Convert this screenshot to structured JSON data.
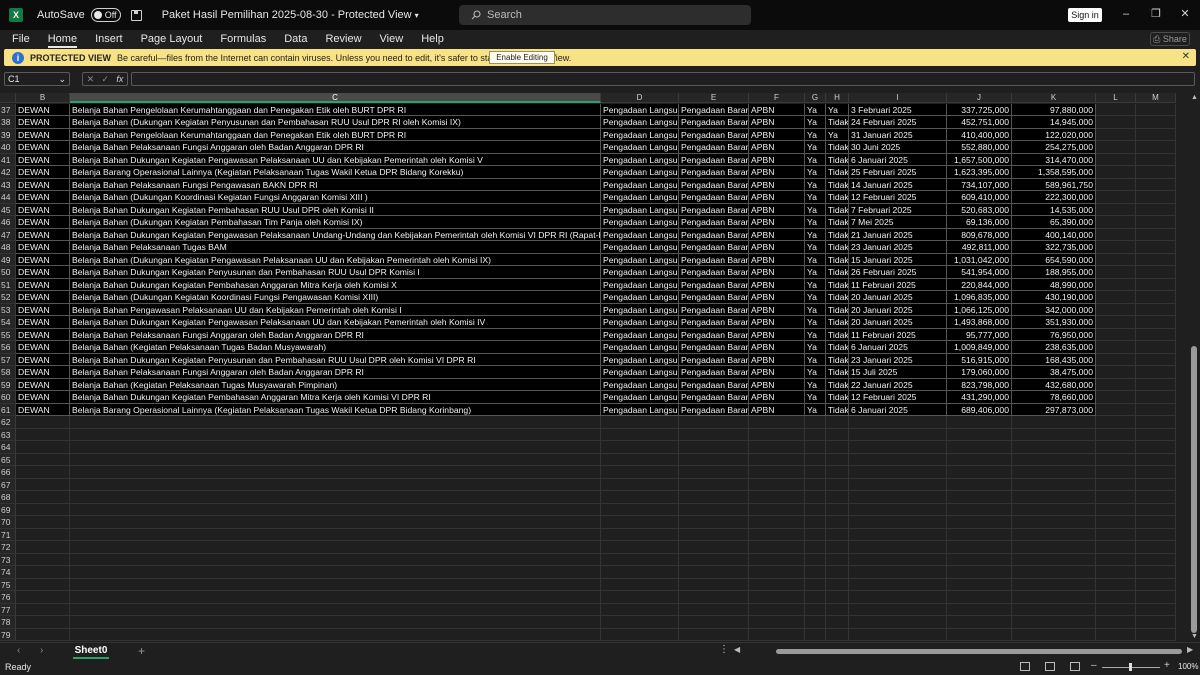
{
  "titlebar": {
    "autosave_label": "AutoSave",
    "autosave_state": "Off",
    "doc_title": "Paket Hasil Pemilihan 2025-08-30  -  Protected View",
    "search_placeholder": "Search",
    "signin_label": "Sign in"
  },
  "menu": [
    "File",
    "Home",
    "Insert",
    "Page Layout",
    "Formulas",
    "Data",
    "Review",
    "View",
    "Help"
  ],
  "menu_active": "Home",
  "share_label": "Share",
  "protected": {
    "label": "PROTECTED VIEW",
    "message": "Be careful—files from the Internet can contain viruses. Unless you need to edit, it's safer to stay in Protected View.",
    "button": "Enable Editing"
  },
  "formula_bar": {
    "namebox": "C1",
    "fx": "fx",
    "value": ""
  },
  "columns": [
    "B",
    "C",
    "D",
    "E",
    "F",
    "G",
    "H",
    "I",
    "J",
    "K",
    "L",
    "M"
  ],
  "selected_column": "C",
  "rows": [
    {
      "n": "37",
      "b": "DEWAN",
      "c": "Belanja Bahan Pengelolaan Kerumahtanggaan dan Penegakan Etik oleh BURT DPR RI",
      "d": "Pengadaan Langsung",
      "e": "Pengadaan Barang",
      "f": "APBN",
      "g": "Ya",
      "h": "Ya",
      "i": "3 Februari 2025",
      "j": "337,725,000",
      "k": "97,880,000"
    },
    {
      "n": "38",
      "b": "DEWAN",
      "c": "Belanja Bahan (Dukungan Kegiatan Penyusunan dan Pembahasan RUU Usul DPR RI oleh Komisi IX)",
      "d": "Pengadaan Langsung",
      "e": "Pengadaan Barang",
      "f": "APBN",
      "g": "Ya",
      "h": "Tidak",
      "i": "24 Februari 2025",
      "j": "452,751,000",
      "k": "14,945,000"
    },
    {
      "n": "39",
      "b": "DEWAN",
      "c": "Belanja Bahan Pengelolaan Kerumahtanggaan dan Penegakan Etik oleh BURT DPR RI",
      "d": "Pengadaan Langsung",
      "e": "Pengadaan Barang",
      "f": "APBN",
      "g": "Ya",
      "h": "Ya",
      "i": "31 Januari 2025",
      "j": "410,400,000",
      "k": "122,020,000"
    },
    {
      "n": "40",
      "b": "DEWAN",
      "c": "Belanja Bahan Pelaksanaan Fungsi Anggaran oleh Badan Anggaran DPR RI",
      "d": "Pengadaan Langsung",
      "e": "Pengadaan Barang",
      "f": "APBN",
      "g": "Ya",
      "h": "Tidak",
      "i": "30 Juni 2025",
      "j": "552,880,000",
      "k": "254,275,000"
    },
    {
      "n": "41",
      "b": "DEWAN",
      "c": "Belanja Bahan Dukungan Kegiatan Pengawasan Pelaksanaan UU dan Kebijakan Pemerintah oleh Komisi V",
      "d": "Pengadaan Langsung",
      "e": "Pengadaan Barang",
      "f": "APBN",
      "g": "Ya",
      "h": "Tidak",
      "i": "6 Januari 2025",
      "j": "1,657,500,000",
      "k": "314,470,000"
    },
    {
      "n": "42",
      "b": "DEWAN",
      "c": "Belanja Barang Operasional Lainnya (Kegiatan  Pelaksanaan Tugas Wakil Ketua DPR Bidang Korekku)",
      "d": "Pengadaan Langsung",
      "e": "Pengadaan Barang",
      "f": "APBN",
      "g": "Ya",
      "h": "Tidak",
      "i": "25 Februari 2025",
      "j": "1,623,395,000",
      "k": "1,358,595,000"
    },
    {
      "n": "43",
      "b": "DEWAN",
      "c": "Belanja Bahan Pelaksanaan Fungsi Pengawasan BAKN DPR RI",
      "d": "Pengadaan Langsung",
      "e": "Pengadaan Barang",
      "f": "APBN",
      "g": "Ya",
      "h": "Tidak",
      "i": "14 Januari 2025",
      "j": "734,107,000",
      "k": "589,961,750"
    },
    {
      "n": "44",
      "b": "DEWAN",
      "c": "Belanja Bahan (Dukungan Koordinasi Kegiatan Fungsi Anggaran Komisi XIII )",
      "d": "Pengadaan Langsung",
      "e": "Pengadaan Barang",
      "f": "APBN",
      "g": "Ya",
      "h": "Tidak",
      "i": "12 Februari 2025",
      "j": "609,410,000",
      "k": "222,300,000"
    },
    {
      "n": "45",
      "b": "DEWAN",
      "c": "Belanja Bahan Dukungan Kegiatan Pembahasan RUU Usul DPR oleh Komisi II",
      "d": "Pengadaan Langsung",
      "e": "Pengadaan Barang",
      "f": "APBN",
      "g": "Ya",
      "h": "Tidak",
      "i": "7 Februari 2025",
      "j": "520,683,000",
      "k": "14,535,000"
    },
    {
      "n": "46",
      "b": "DEWAN",
      "c": "Belanja Bahan (Dukungan Kegiatan Pembahasan Tim Panja oleh Komisi IX)",
      "d": "Pengadaan Langsung",
      "e": "Pengadaan Barang",
      "f": "APBN",
      "g": "Ya",
      "h": "Tidak",
      "i": "7 Mei 2025",
      "j": "69,136,000",
      "k": "65,390,000"
    },
    {
      "n": "47",
      "b": "DEWAN",
      "c": "Belanja Bahan Dukungan Kegiatan Pengawasan Pelaksanaan Undang-Undang dan Kebijakan Pemerintah oleh Komisi VI DPR RI (Rapat-Rapat)",
      "d": "Pengadaan Langsung",
      "e": "Pengadaan Barang",
      "f": "APBN",
      "g": "Ya",
      "h": "Tidak",
      "i": "21 Januari 2025",
      "j": "809,678,000",
      "k": "400,140,000"
    },
    {
      "n": "48",
      "b": "DEWAN",
      "c": "Belanja Bahan Pelaksanaan Tugas BAM",
      "d": "Pengadaan Langsung",
      "e": "Pengadaan Barang",
      "f": "APBN",
      "g": "Ya",
      "h": "Tidak",
      "i": "23 Januari 2025",
      "j": "492,811,000",
      "k": "322,735,000"
    },
    {
      "n": "49",
      "b": "DEWAN",
      "c": "Belanja Bahan (Dukungan Kegiatan Pengawasan Pelaksanaan UU dan Kebijakan Pemerintah oleh Komisi IX)",
      "d": "Pengadaan Langsung",
      "e": "Pengadaan Barang",
      "f": "APBN",
      "g": "Ya",
      "h": "Tidak",
      "i": "15 Januari 2025",
      "j": "1,031,042,000",
      "k": "654,590,000"
    },
    {
      "n": "50",
      "b": "DEWAN",
      "c": "Belanja Bahan Dukungan Kegiatan Penyusunan dan Pembahasan RUU Usul DPR  Komisi I",
      "d": "Pengadaan Langsung",
      "e": "Pengadaan Barang",
      "f": "APBN",
      "g": "Ya",
      "h": "Tidak",
      "i": "26 Februari 2025",
      "j": "541,954,000",
      "k": "188,955,000"
    },
    {
      "n": "51",
      "b": "DEWAN",
      "c": "Belanja Bahan Dukungan Kegiatan Pembahasan Anggaran Mitra Kerja oleh Komisi X",
      "d": "Pengadaan Langsung",
      "e": "Pengadaan Barang",
      "f": "APBN",
      "g": "Ya",
      "h": "Tidak",
      "i": "11 Februari 2025",
      "j": "220,844,000",
      "k": "48,990,000"
    },
    {
      "n": "52",
      "b": "DEWAN",
      "c": "Belanja Bahan (Dukungan Kegiatan Koordinasi Fungsi Pengawasan Komisi XIII)",
      "d": "Pengadaan Langsung",
      "e": "Pengadaan Barang",
      "f": "APBN",
      "g": "Ya",
      "h": "Tidak",
      "i": "20 Januari 2025",
      "j": "1,096,835,000",
      "k": "430,190,000"
    },
    {
      "n": "53",
      "b": "DEWAN",
      "c": "Belanja Bahan Pengawasan Pelaksanaan UU dan Kebijakan Pemerintah oleh Komisi I",
      "d": "Pengadaan Langsung",
      "e": "Pengadaan Barang",
      "f": "APBN",
      "g": "Ya",
      "h": "Tidak",
      "i": "20 Januari 2025",
      "j": "1,066,125,000",
      "k": "342,000,000"
    },
    {
      "n": "54",
      "b": "DEWAN",
      "c": "Belanja Bahan Dukungan Kegiatan Pengawasan Pelaksanaan UU dan Kebijakan Pemerintah oleh Komisi IV",
      "d": "Pengadaan Langsung",
      "e": "Pengadaan Barang",
      "f": "APBN",
      "g": "Ya",
      "h": "Tidak",
      "i": "20 Januari 2025",
      "j": "1,493,868,000",
      "k": "351,930,000"
    },
    {
      "n": "55",
      "b": "DEWAN",
      "c": "Belanja Bahan Pelaksanaan Fungsi Anggaran oleh Badan Anggaran DPR RI",
      "d": "Pengadaan Langsung",
      "e": "Pengadaan Barang",
      "f": "APBN",
      "g": "Ya",
      "h": "Tidak",
      "i": "11 Februari 2025",
      "j": "95,777,000",
      "k": "76,950,000"
    },
    {
      "n": "56",
      "b": "DEWAN",
      "c": "Belanja Bahan (Kegiatan  Pelaksanaan Tugas Badan Musyawarah)",
      "d": "Pengadaan Langsung",
      "e": "Pengadaan Barang",
      "f": "APBN",
      "g": "Ya",
      "h": "Tidak",
      "i": "6 Januari 2025",
      "j": "1,009,849,000",
      "k": "238,635,000"
    },
    {
      "n": "57",
      "b": "DEWAN",
      "c": "Belanja Bahan Dukungan Kegiatan Penyusunan dan Pembahasan RUU Usul DPR oleh Komisi VI DPR RI",
      "d": "Pengadaan Langsung",
      "e": "Pengadaan Barang",
      "f": "APBN",
      "g": "Ya",
      "h": "Tidak",
      "i": "23 Januari 2025",
      "j": "516,915,000",
      "k": "168,435,000"
    },
    {
      "n": "58",
      "b": "DEWAN",
      "c": "Belanja Bahan Pelaksanaan Fungsi Anggaran oleh Badan Anggaran DPR RI",
      "d": "Pengadaan Langsung",
      "e": "Pengadaan Barang",
      "f": "APBN",
      "g": "Ya",
      "h": "Tidak",
      "i": "15 Juli 2025",
      "j": "179,060,000",
      "k": "38,475,000"
    },
    {
      "n": "59",
      "b": "DEWAN",
      "c": "Belanja Bahan (Kegiatan  Pelaksanaan Tugas Musyawarah Pimpinan)",
      "d": "Pengadaan Langsung",
      "e": "Pengadaan Barang",
      "f": "APBN",
      "g": "Ya",
      "h": "Tidak",
      "i": "22 Januari 2025",
      "j": "823,798,000",
      "k": "432,680,000"
    },
    {
      "n": "60",
      "b": "DEWAN",
      "c": "Belanja Bahan Dukungan Kegiatan Pembahasan Anggaran Mitra Kerja oleh Komisi VI DPR RI",
      "d": "Pengadaan Langsung",
      "e": "Pengadaan Barang",
      "f": "APBN",
      "g": "Ya",
      "h": "Tidak",
      "i": "12 Februari 2025",
      "j": "431,290,000",
      "k": "78,660,000"
    },
    {
      "n": "61",
      "b": "DEWAN",
      "c": "Belanja Barang Operasional Lainnya (Kegiatan  Pelaksanaan Tugas Wakil Ketua DPR Bidang Korinbang)",
      "d": "Pengadaan Langsung",
      "e": "Pengadaan Barang",
      "f": "APBN",
      "g": "Ya",
      "h": "Tidak",
      "i": "6 Januari 2025",
      "j": "689,406,000",
      "k": "297,873,000"
    }
  ],
  "empty_rows": [
    "62",
    "63",
    "64",
    "65",
    "66",
    "67",
    "68",
    "69",
    "70",
    "71",
    "72",
    "73",
    "74",
    "75",
    "76",
    "77",
    "78",
    "79"
  ],
  "sheet_tab": "Sheet0",
  "status": "Ready",
  "zoom": "100%"
}
